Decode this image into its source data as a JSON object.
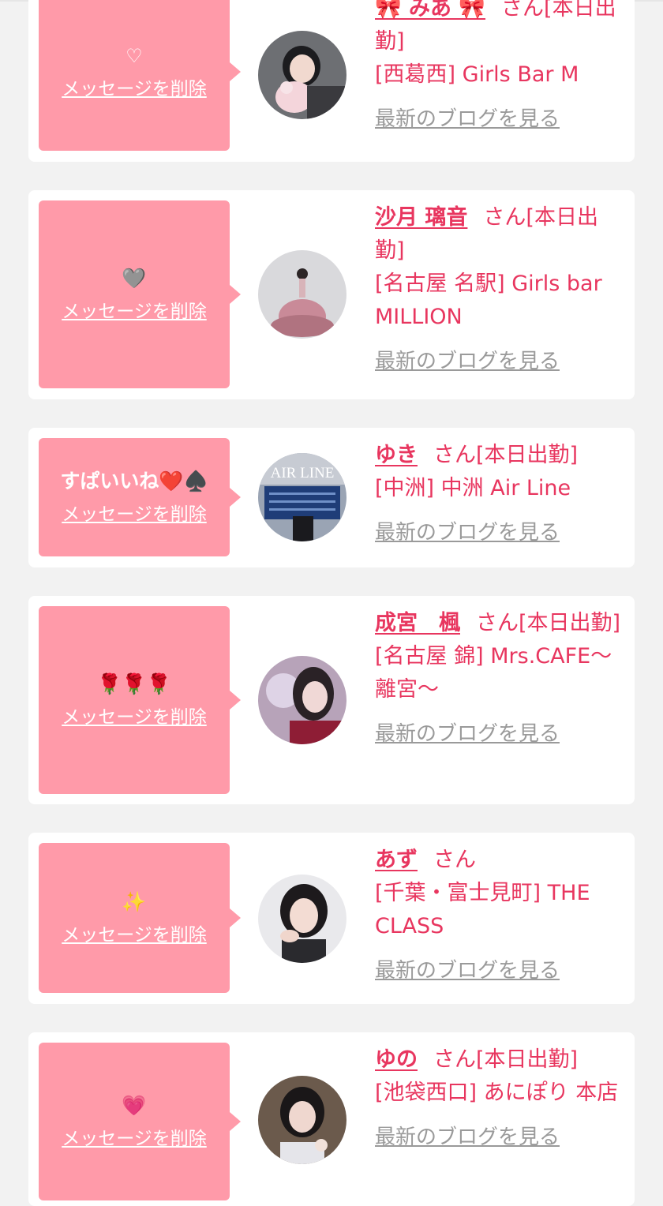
{
  "messages": [
    {
      "text": "♡",
      "delete_label": "メッセージを削除",
      "name": "🎀 みあ 🎀",
      "honorific": "さん[本日出勤]",
      "shop": "[西葛西] Girls Bar M",
      "blog_label": "最新のブログを見る"
    },
    {
      "text": "🩶",
      "delete_label": "メッセージを削除",
      "name": "沙月 璃音",
      "honorific": "さん[本日出勤]",
      "shop": "[名古屋 名駅] Girls bar MILLION",
      "blog_label": "最新のブログを見る"
    },
    {
      "text": "すぱいいね❤️♠️",
      "delete_label": "メッセージを削除",
      "name": "ゆき",
      "honorific": "さん[本日出勤]",
      "shop": "[中洲] 中洲 Air Line",
      "blog_label": "最新のブログを見る",
      "avatar_sign": "AIR LINE"
    },
    {
      "text": "🌹🌹🌹",
      "delete_label": "メッセージを削除",
      "name": "成宮　楓",
      "honorific": "さん[本日出勤]",
      "shop": "[名古屋 錦] Mrs.CAFE〜離宮〜",
      "blog_label": "最新のブログを見る"
    },
    {
      "text": "✨",
      "delete_label": "メッセージを削除",
      "name": "あず",
      "honorific": "さん",
      "shop": "[千葉・富士見町] THE CLASS",
      "blog_label": "最新のブログを見る"
    },
    {
      "text": "💗",
      "delete_label": "メッセージを削除",
      "name": "ゆの",
      "honorific": "さん[本日出勤]",
      "shop": "[池袋西口] あにぽり 本店",
      "blog_label": "最新のブログを見る"
    }
  ]
}
